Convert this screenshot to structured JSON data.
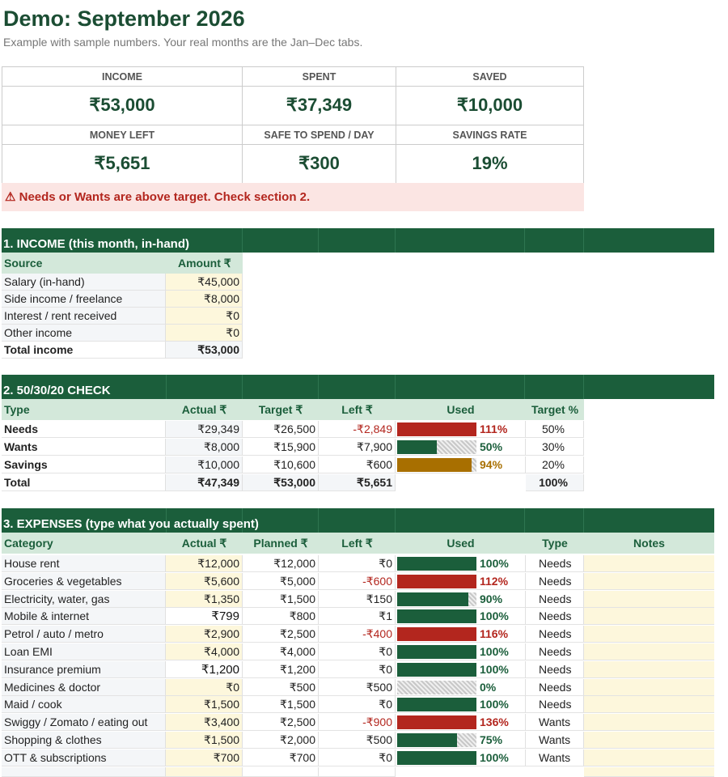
{
  "title": "Demo: September 2026",
  "subtitle": "Example with sample numbers. Your real months are the Jan–Dec tabs.",
  "kpis": [
    {
      "label": "INCOME",
      "value": "₹53,000"
    },
    {
      "label": "SPENT",
      "value": "₹37,349"
    },
    {
      "label": "SAVED",
      "value": "₹10,000"
    },
    {
      "label": "MONEY LEFT",
      "value": "₹5,651"
    },
    {
      "label": "SAFE TO SPEND / DAY",
      "value": "₹300"
    },
    {
      "label": "SAVINGS RATE",
      "value": "19%"
    }
  ],
  "alert": "⚠ Needs or Wants are above target. Check section 2.",
  "income": {
    "title": "1. INCOME (this month, in-hand)",
    "headers": {
      "source": "Source",
      "amount": "Amount ₹"
    },
    "rows": [
      {
        "source": "Salary (in-hand)",
        "amount": "₹45,000"
      },
      {
        "source": "Side income / freelance",
        "amount": "₹8,000"
      },
      {
        "source": "Interest / rent received",
        "amount": "₹0"
      },
      {
        "source": "Other income",
        "amount": "₹0"
      }
    ],
    "total": {
      "source": "Total income",
      "amount": "₹53,000"
    }
  },
  "check": {
    "title": "2. 50/30/20 CHECK",
    "headers": {
      "type": "Type",
      "actual": "Actual ₹",
      "target": "Target ₹",
      "left": "Left ₹",
      "used": "Used",
      "target_pct": "Target %"
    },
    "rows": [
      {
        "type": "Needs",
        "actual": "₹29,349",
        "target": "₹26,500",
        "left": "-₹2,849",
        "neg": true,
        "used": 111,
        "used_label": "111%",
        "color": "#b3261e",
        "target_pct": "50%"
      },
      {
        "type": "Wants",
        "actual": "₹8,000",
        "target": "₹15,900",
        "left": "₹7,900",
        "neg": false,
        "used": 50,
        "used_label": "50%",
        "color": "#1b5e3b",
        "target_pct": "30%"
      },
      {
        "type": "Savings",
        "actual": "₹10,000",
        "target": "₹10,600",
        "left": "₹600",
        "neg": false,
        "used": 94,
        "used_label": "94%",
        "color": "#a86f00",
        "target_pct": "20%"
      }
    ],
    "total": {
      "type": "Total",
      "actual": "₹47,349",
      "target": "₹53,000",
      "left": "₹5,651",
      "target_pct": "100%"
    }
  },
  "expenses": {
    "title": "3. EXPENSES (type what you actually spent)",
    "headers": {
      "category": "Category",
      "actual": "Actual ₹",
      "planned": "Planned ₹",
      "left": "Left ₹",
      "used": "Used",
      "type": "Type",
      "notes": "Notes"
    },
    "rows": [
      {
        "category": "House rent",
        "actual": "₹12,000",
        "planned": "₹12,000",
        "left": "₹0",
        "neg": false,
        "used": 100,
        "used_label": "100%",
        "type": "Needs",
        "white": false
      },
      {
        "category": "Groceries & vegetables",
        "actual": "₹5,600",
        "planned": "₹5,000",
        "left": "-₹600",
        "neg": true,
        "used": 112,
        "used_label": "112%",
        "type": "Needs",
        "white": false
      },
      {
        "category": "Electricity, water, gas",
        "actual": "₹1,350",
        "planned": "₹1,500",
        "left": "₹150",
        "neg": false,
        "used": 90,
        "used_label": "90%",
        "type": "Needs",
        "white": false
      },
      {
        "category": "Mobile & internet",
        "actual": "₹799",
        "planned": "₹800",
        "left": "₹1",
        "neg": false,
        "used": 100,
        "used_label": "100%",
        "type": "Needs",
        "white": true
      },
      {
        "category": "Petrol / auto / metro",
        "actual": "₹2,900",
        "planned": "₹2,500",
        "left": "-₹400",
        "neg": true,
        "used": 116,
        "used_label": "116%",
        "type": "Needs",
        "white": false
      },
      {
        "category": "Loan EMI",
        "actual": "₹4,000",
        "planned": "₹4,000",
        "left": "₹0",
        "neg": false,
        "used": 100,
        "used_label": "100%",
        "type": "Needs",
        "white": false
      },
      {
        "category": "Insurance premium",
        "actual": "₹1,200",
        "planned": "₹1,200",
        "left": "₹0",
        "neg": false,
        "used": 100,
        "used_label": "100%",
        "type": "Needs",
        "white": true
      },
      {
        "category": "Medicines & doctor",
        "actual": "₹0",
        "planned": "₹500",
        "left": "₹500",
        "neg": false,
        "used": 0,
        "used_label": "0%",
        "type": "Needs",
        "white": false
      },
      {
        "category": "Maid / cook",
        "actual": "₹1,500",
        "planned": "₹1,500",
        "left": "₹0",
        "neg": false,
        "used": 100,
        "used_label": "100%",
        "type": "Needs",
        "white": false
      },
      {
        "category": "Swiggy / Zomato / eating out",
        "actual": "₹3,400",
        "planned": "₹2,500",
        "left": "-₹900",
        "neg": true,
        "used": 136,
        "used_label": "136%",
        "type": "Wants",
        "white": false
      },
      {
        "category": "Shopping & clothes",
        "actual": "₹1,500",
        "planned": "₹2,000",
        "left": "₹500",
        "neg": false,
        "used": 75,
        "used_label": "75%",
        "type": "Wants",
        "white": false
      },
      {
        "category": "OTT & subscriptions",
        "actual": "₹700",
        "planned": "₹700",
        "left": "₹0",
        "neg": false,
        "used": 100,
        "used_label": "100%",
        "type": "Wants",
        "white": false
      }
    ]
  },
  "colors": {
    "ok": "#1b5e3b",
    "over": "#b3261e",
    "warn": "#a86f00",
    "warn_text": "#a86f00"
  }
}
